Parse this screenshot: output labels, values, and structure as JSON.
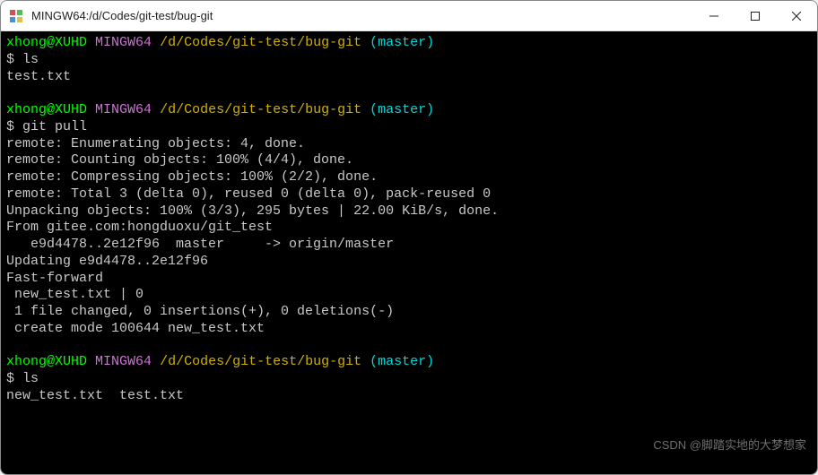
{
  "window": {
    "title": "MINGW64:/d/Codes/git-test/bug-git"
  },
  "colors": {
    "user": "#00ff00",
    "env": "#d070d8",
    "path": "#d0b000",
    "branch": "#00d8d8",
    "text": "#c8c8c8",
    "bg": "#000000"
  },
  "prompt": {
    "user": "xhong@XUHD",
    "env": "MINGW64",
    "path": "/d/Codes/git-test/bug-git",
    "branch": "(master)",
    "symbol": "$"
  },
  "blocks": [
    {
      "command": "ls",
      "output": [
        "test.txt"
      ]
    },
    {
      "command": "git pull",
      "output": [
        "remote: Enumerating objects: 4, done.",
        "remote: Counting objects: 100% (4/4), done.",
        "remote: Compressing objects: 100% (2/2), done.",
        "remote: Total 3 (delta 0), reused 0 (delta 0), pack-reused 0",
        "Unpacking objects: 100% (3/3), 295 bytes | 22.00 KiB/s, done.",
        "From gitee.com:hongduoxu/git_test",
        "   e9d4478..2e12f96  master     -> origin/master",
        "Updating e9d4478..2e12f96",
        "Fast-forward",
        " new_test.txt | 0",
        " 1 file changed, 0 insertions(+), 0 deletions(-)",
        " create mode 100644 new_test.txt"
      ]
    },
    {
      "command": "ls",
      "output": [
        "new_test.txt  test.txt"
      ]
    }
  ],
  "watermark": "CSDN @脚踏实地的大梦想家"
}
